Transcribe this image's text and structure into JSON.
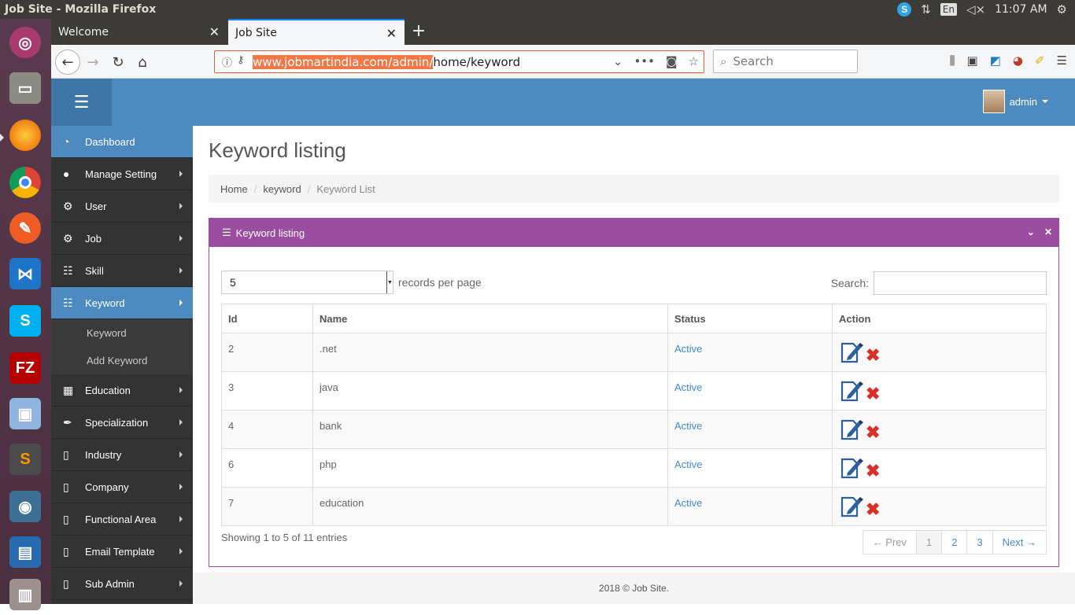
{
  "os": {
    "window_title": "Job Site - Mozilla Firefox",
    "keyboard_layout": "En",
    "clock": "11:07 AM"
  },
  "browser": {
    "tabs": [
      {
        "label": "Welcome",
        "active": false
      },
      {
        "label": "Job Site",
        "active": true
      }
    ],
    "url_highlight": "www.jobmartindia.com/admin/",
    "url_rest": "home/keyword",
    "search_placeholder": "Search"
  },
  "header": {
    "username": "admin"
  },
  "sidebar": {
    "items": [
      {
        "label": "Dashboard",
        "icon": "dashboard-icon"
      },
      {
        "label": "Manage Setting",
        "icon": "user-icon"
      },
      {
        "label": "User",
        "icon": "gears-icon"
      },
      {
        "label": "Job",
        "icon": "gears-icon"
      },
      {
        "label": "Skill",
        "icon": "list-icon"
      },
      {
        "label": "Keyword",
        "icon": "list-icon",
        "active": true
      },
      {
        "label": "Education",
        "icon": "grid-icon"
      },
      {
        "label": "Specialization",
        "icon": "pen-icon"
      },
      {
        "label": "Industry",
        "icon": "file-icon"
      },
      {
        "label": "Company",
        "icon": "file-icon"
      },
      {
        "label": "Functional Area",
        "icon": "file-icon"
      },
      {
        "label": "Email Template",
        "icon": "file-icon"
      },
      {
        "label": "Sub Admin",
        "icon": "file-icon"
      }
    ],
    "keyword_sub": [
      "Keyword",
      "Add Keyword"
    ]
  },
  "page": {
    "title": "Keyword listing",
    "breadcrumb": [
      "Home",
      "keyword",
      "Keyword List"
    ],
    "panel_title": "Keyword listing",
    "page_length": "5",
    "page_length_suffix": "records per page",
    "search_label": "Search:",
    "columns": [
      "Id",
      "Name",
      "Status",
      "Action"
    ],
    "rows": [
      {
        "id": "2",
        "name": ".net",
        "status": "Active"
      },
      {
        "id": "3",
        "name": "java",
        "status": "Active"
      },
      {
        "id": "4",
        "name": "bank",
        "status": "Active"
      },
      {
        "id": "6",
        "name": "php",
        "status": "Active"
      },
      {
        "id": "7",
        "name": "education",
        "status": "Active"
      }
    ],
    "info": "Showing 1 to 5 of 11 entries",
    "pagination": {
      "prev": "← Prev",
      "pages": [
        "1",
        "2",
        "3"
      ],
      "current": "1",
      "next": "Next →"
    },
    "footer": "2018 © Job Site."
  },
  "colors": {
    "header_blue": "#4d8ac0",
    "panel_purple": "#9b4e9f",
    "link_blue": "#428bca",
    "delete_red": "#d9312a"
  }
}
